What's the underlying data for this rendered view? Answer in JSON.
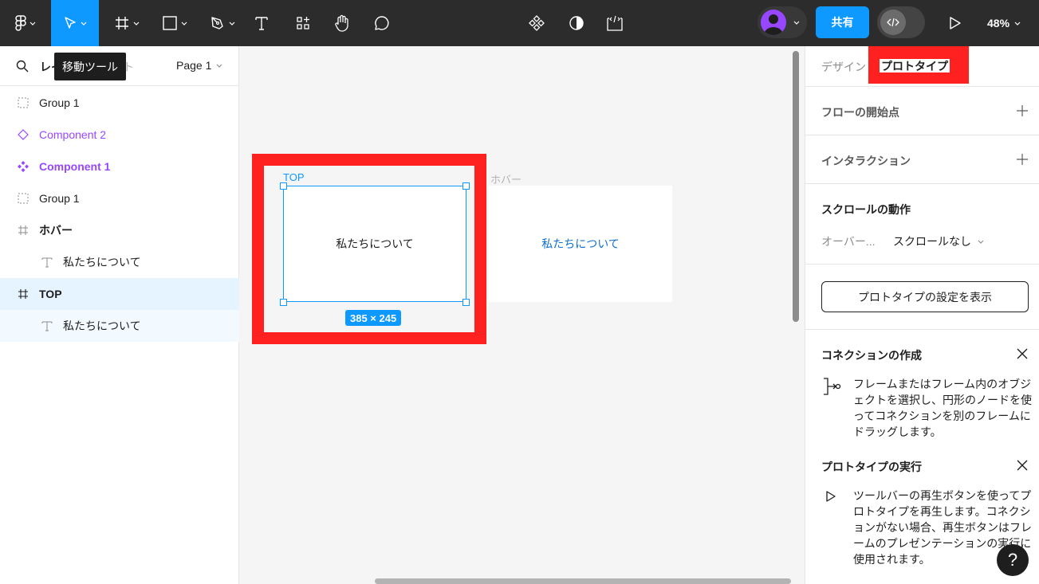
{
  "toolbar": {
    "share_label": "共有",
    "zoom_label": "48%",
    "tooltip": "移動ツール"
  },
  "left_panel": {
    "tab_layers": "レイ",
    "tab_assets": "ット",
    "page_label": "Page 1",
    "layers": [
      {
        "label": "Group 1",
        "icon": "group-icon",
        "color": "#1e1e1e"
      },
      {
        "label": "Component 2",
        "icon": "component-instance-icon",
        "color": "#9747ff"
      },
      {
        "label": "Component 1",
        "icon": "component-icon",
        "color": "#9747ff"
      },
      {
        "label": "Group 1",
        "icon": "group-icon",
        "color": "#1e1e1e"
      },
      {
        "label": "ホバー",
        "icon": "frame-icon",
        "color": "#1e1e1e"
      },
      {
        "label": "私たちについて",
        "icon": "text-icon",
        "color": "#1e1e1e"
      },
      {
        "label": "TOP",
        "icon": "frame-icon",
        "color": "#1e1e1e"
      },
      {
        "label": "私たちについて",
        "icon": "text-icon",
        "color": "#1e1e1e"
      }
    ]
  },
  "canvas": {
    "frame_top_label": "TOP",
    "frame_top_text": "私たちについて",
    "frame_hover_label": "ホバー",
    "frame_hover_text": "私たちについて",
    "size_badge": "385 × 245",
    "highlight_color": "#ff2020",
    "selection_color": "#0d99ff"
  },
  "right_panel": {
    "tab_design": "デザイン",
    "tab_prototype": "プロトタイプ",
    "flow_start": "フローの開始点",
    "interaction": "インタラクション",
    "scroll_behavior": "スクロールの動作",
    "overflow_label": "オーバー...",
    "overflow_value": "スクロールなし",
    "settings_button": "プロトタイプの設定を表示",
    "connection_title": "コネクションの作成",
    "connection_desc": "フレームまたはフレーム内のオブジェクトを選択し、円形のノードを使ってコネクションを別のフレームにドラッグします。",
    "run_title": "プロトタイプの実行",
    "run_desc": "ツールバーの再生ボタンを使ってプロトタイプを再生します。コネクションがない場合、再生ボタンはフレームのプレゼンテーションの実行に使用されます。",
    "help": "?"
  }
}
